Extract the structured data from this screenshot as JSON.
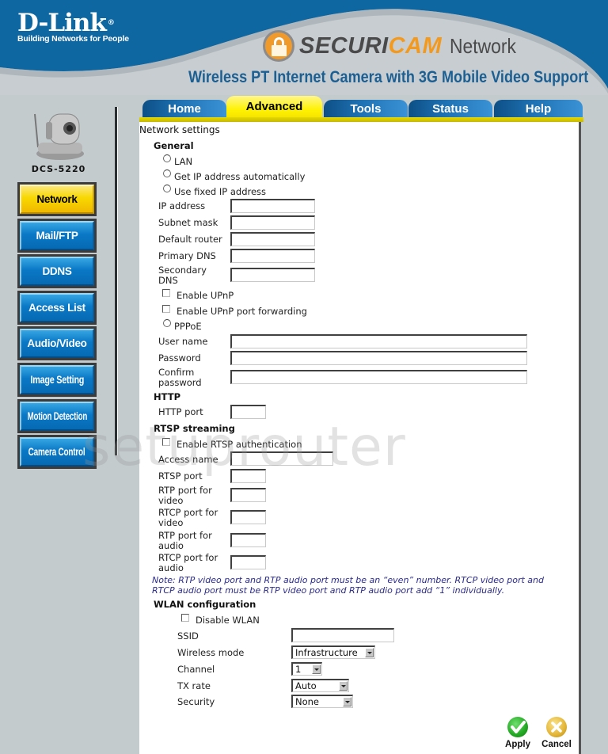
{
  "header": {
    "brand": "D-Link",
    "brand_mark": "®",
    "tagline": "Building Networks for People",
    "product_line_a": "SECURI",
    "product_line_b": "CAM",
    "product_line_suffix": "Network",
    "product_title": "Wireless PT Internet Camera with 3G Mobile Video Support",
    "colors": {
      "brand_blue": "#0f67a2",
      "accent_orange": "#f39a1e",
      "title_blue": "#1c5f93"
    }
  },
  "tabs": [
    {
      "label": "Home",
      "active": false
    },
    {
      "label": "Advanced",
      "active": true
    },
    {
      "label": "Tools",
      "active": false
    },
    {
      "label": "Status",
      "active": false
    },
    {
      "label": "Help",
      "active": false
    }
  ],
  "sidebar": {
    "model": "DCS-5220",
    "items": [
      {
        "label": "Network",
        "active": true
      },
      {
        "label": "Mail/FTP",
        "active": false
      },
      {
        "label": "DDNS",
        "active": false
      },
      {
        "label": "Access List",
        "active": false
      },
      {
        "label": "Audio/Video",
        "active": false
      },
      {
        "label": "Image Setting",
        "active": false
      },
      {
        "label": "Motion Detection",
        "active": false
      },
      {
        "label": "Camera Control",
        "active": false
      }
    ]
  },
  "page": {
    "title": "Network settings",
    "general": {
      "heading": "General",
      "lan_label": "LAN",
      "dhcp_label": "Get IP address automatically",
      "fixed_label": "Use fixed IP address",
      "ip_address": {
        "label": "IP address",
        "value": ""
      },
      "subnet_mask": {
        "label": "Subnet mask",
        "value": ""
      },
      "default_router": {
        "label": "Default router",
        "value": ""
      },
      "primary_dns": {
        "label": "Primary DNS",
        "value": ""
      },
      "secondary_dns": {
        "label_1": "Secondary",
        "label_2": "DNS",
        "value": ""
      },
      "upnp_label": "Enable UPnP",
      "upnp_pf_label": "Enable UPnP port forwarding",
      "pppoe_label": "PPPoE",
      "user_name": {
        "label": "User name",
        "value": ""
      },
      "password": {
        "label": "Password",
        "value": ""
      },
      "confirm_password": {
        "label_1": "Confirm",
        "label_2": "password",
        "value": ""
      }
    },
    "http": {
      "heading": "HTTP",
      "port": {
        "label": "HTTP port",
        "value": ""
      }
    },
    "rtsp": {
      "heading": "RTSP streaming",
      "auth_label": "Enable RTSP authentication",
      "access_name": {
        "label": "Access name",
        "value": ""
      },
      "rtsp_port": {
        "label": "RTSP port",
        "value": ""
      },
      "rtp_video": {
        "label_1": "RTP port for",
        "label_2": "video",
        "value": ""
      },
      "rtcp_video": {
        "label_1": "RTCP port for",
        "label_2": "video",
        "value": ""
      },
      "rtp_audio": {
        "label_1": "RTP port for",
        "label_2": "audio",
        "value": ""
      },
      "rtcp_audio": {
        "label_1": "RTCP port for",
        "label_2": "audio",
        "value": ""
      },
      "note_1": "Note: RTP video port and RTP audio port must be an “even” number. RTCP video port and",
      "note_2": "RTCP audio port must be RTP video port and RTP audio port add “1” individually."
    },
    "wlan": {
      "heading": "WLAN configuration",
      "disable_label": "Disable WLAN",
      "ssid": {
        "label": "SSID",
        "value": ""
      },
      "wireless_mode": {
        "label": "Wireless mode",
        "value": "Infrastructure"
      },
      "channel": {
        "label": "Channel",
        "value": "1"
      },
      "tx_rate": {
        "label": "TX rate",
        "value": "Auto"
      },
      "security": {
        "label": "Security",
        "value": "None"
      }
    },
    "actions": {
      "apply": "Apply",
      "cancel": "Cancel"
    }
  },
  "watermark": "setuprouter"
}
